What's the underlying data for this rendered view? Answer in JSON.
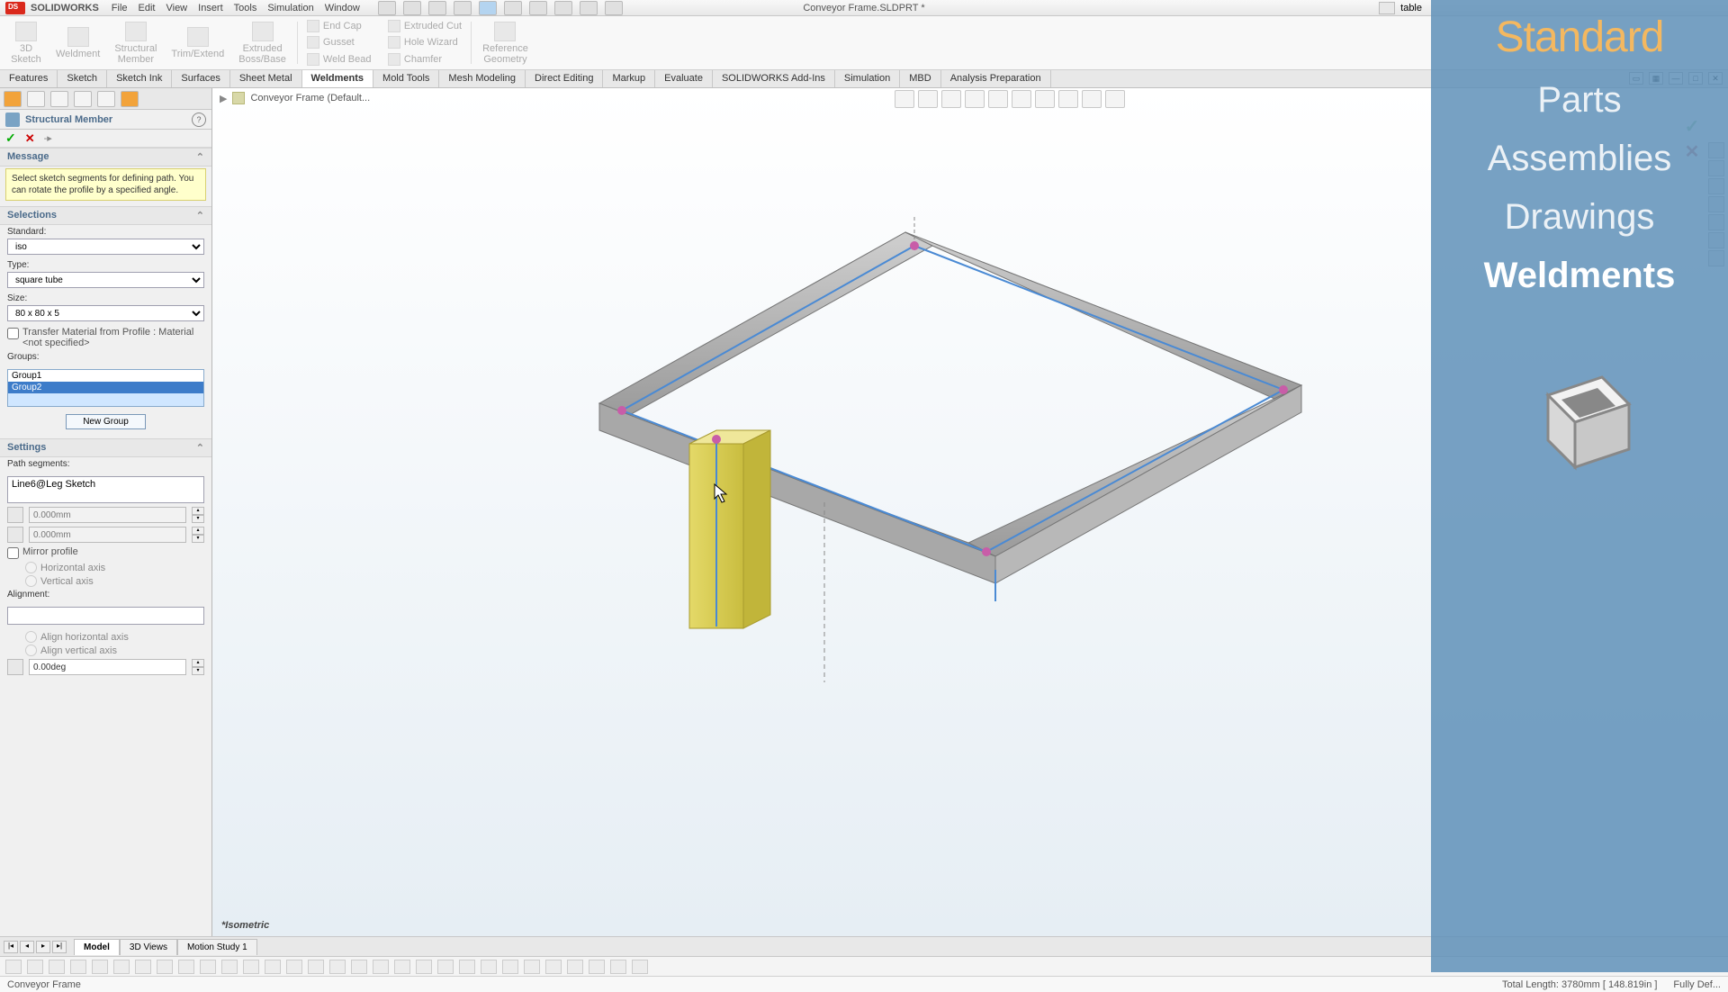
{
  "titlebar": {
    "app": "SOLIDWORKS",
    "menus": [
      "File",
      "Edit",
      "View",
      "Insert",
      "Tools",
      "Simulation",
      "Window"
    ],
    "doc_title": "Conveyor Frame.SLDPRT *",
    "search_label": "table"
  },
  "ribbon": {
    "big": [
      {
        "label": "3D\nSketch"
      },
      {
        "label": "Weldment"
      },
      {
        "label": "Structural\nMember"
      },
      {
        "label": "Trim/Extend"
      },
      {
        "label": "Extruded\nBoss/Base"
      }
    ],
    "small1": [
      "End Cap",
      "Gusset",
      "Weld Bead"
    ],
    "small2": [
      "Extruded Cut",
      "Hole Wizard",
      "Chamfer"
    ],
    "ref": "Reference\nGeometry"
  },
  "tabs": [
    "Features",
    "Sketch",
    "Sketch Ink",
    "Surfaces",
    "Sheet Metal",
    "Weldments",
    "Mold Tools",
    "Mesh Modeling",
    "Direct Editing",
    "Markup",
    "Evaluate",
    "SOLIDWORKS Add-Ins",
    "Simulation",
    "MBD",
    "Analysis Preparation"
  ],
  "active_tab": "Weldments",
  "pm": {
    "title": "Structural Member",
    "message_head": "Message",
    "message": "Select sketch segments for defining path. You can rotate the profile by a specified angle.",
    "selections_head": "Selections",
    "standard_label": "Standard:",
    "standard_value": "iso",
    "type_label": "Type:",
    "type_value": "square tube",
    "size_label": "Size:",
    "size_value": "80 x 80 x 5",
    "transfer_label": "Transfer Material from Profile : Material <not specified>",
    "groups_label": "Groups:",
    "groups": [
      "Group1",
      "Group2"
    ],
    "new_group": "New Group",
    "settings_head": "Settings",
    "path_label": "Path segments:",
    "path_value": "Line6@Leg Sketch",
    "offset1": "0.000mm",
    "offset2": "0.000mm",
    "mirror_label": "Mirror profile",
    "mirror_h": "Horizontal axis",
    "mirror_v": "Vertical axis",
    "align_label": "Alignment:",
    "align_h": "Align horizontal axis",
    "align_v": "Align vertical axis",
    "angle": "0.00deg"
  },
  "breadcrumb": {
    "label": "Conveyor Frame  (Default..."
  },
  "view_label": "*Isometric",
  "bottom_tabs": [
    "Model",
    "3D Views",
    "Motion Study 1"
  ],
  "status": {
    "left": "Conveyor Frame",
    "length": "Total Length: 3780mm  [ 148.819in ]",
    "defined": "Fully Def..."
  },
  "overlay": {
    "brand": "Standard",
    "items": [
      "Parts",
      "Assemblies",
      "Drawings",
      "Weldments"
    ],
    "active": "Weldments"
  }
}
